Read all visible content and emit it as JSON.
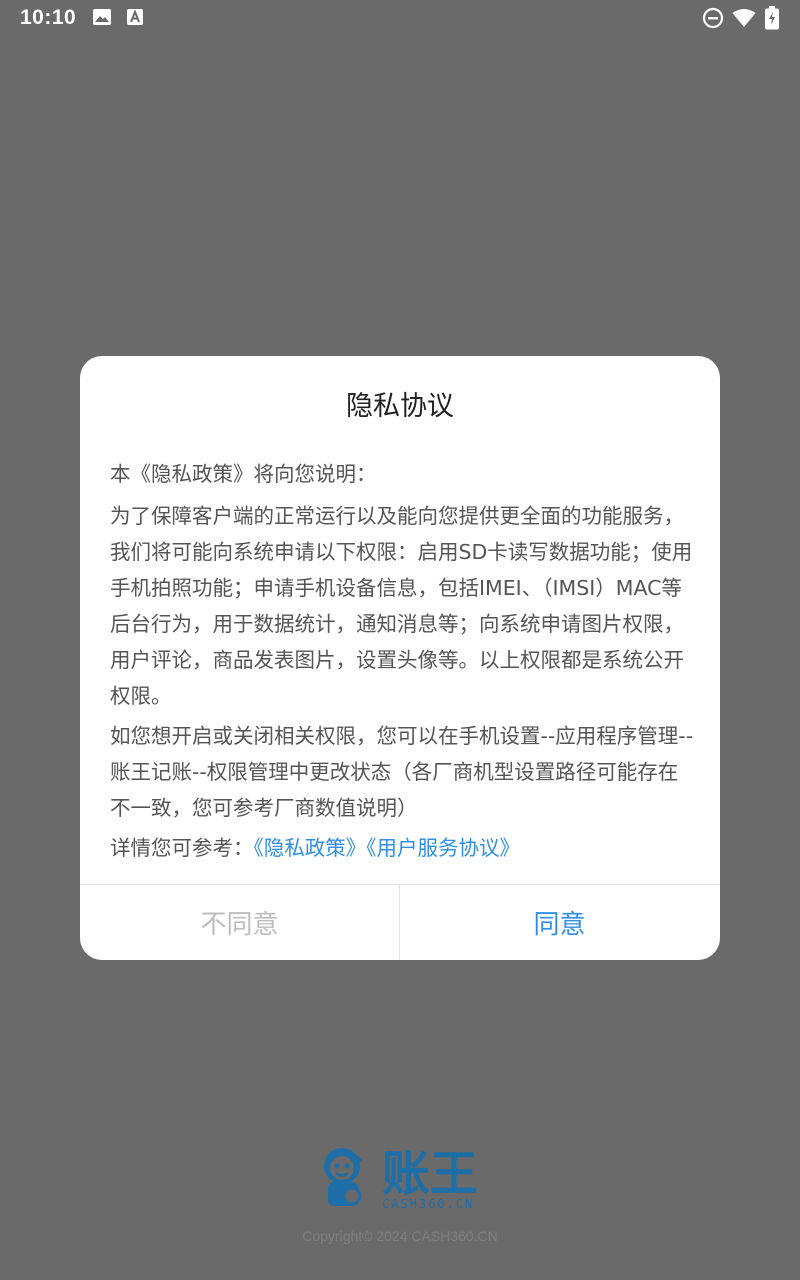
{
  "status_bar": {
    "time": "10:10",
    "icons": [
      "image-icon",
      "text-a-icon",
      "do-not-disturb-icon",
      "wifi-icon",
      "battery-charging-icon"
    ]
  },
  "dialog": {
    "title": "隐私协议",
    "intro": "本《隐私政策》将向您说明：",
    "paragraph1": "为了保障客户端的正常运行以及能向您提供更全面的功能服务，我们将可能向系统申请以下权限：启用SD卡读写数据功能；使用手机拍照功能；申请手机设备信息，包括IMEI、（IMSI）MAC等后台行为，用于数据统计，通知消息等；向系统申请图片权限，用户评论，商品发表图片，设置头像等。以上权限都是系统公开权限。",
    "paragraph2": "如您想开启或关闭相关权限，您可以在手机设置--应用程序管理-- 账王记账--权限管理中更改状态（各厂商机型设置路径可能存在不一致，您可参考厂商数值说明）",
    "details_prefix": "详情您可参考：",
    "privacy_link": "《隐私政策》",
    "service_link": "《用户服务协议》",
    "disagree_label": "不同意",
    "agree_label": "同意"
  },
  "footer": {
    "logo_text": "账王",
    "logo_subtext": "CASH360.CN",
    "copyright": "Copyright© 2024 CASH360.CN"
  },
  "colors": {
    "overlay": "#6a6a6a",
    "accent": "#2f8fe6",
    "disabled": "#bdbdbd",
    "logo": "#1e6ea8"
  }
}
